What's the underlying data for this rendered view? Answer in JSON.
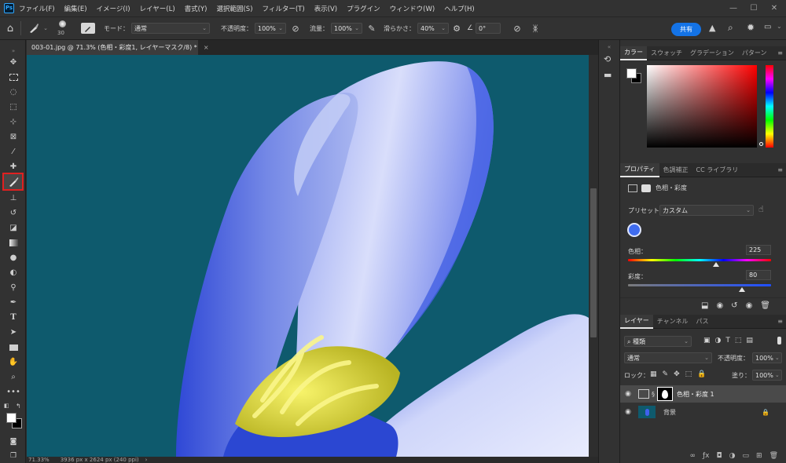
{
  "app": {
    "logo": "Ps"
  },
  "menu": [
    "ファイル(F)",
    "編集(E)",
    "イメージ(I)",
    "レイヤー(L)",
    "書式(Y)",
    "選択範囲(S)",
    "フィルター(T)",
    "表示(V)",
    "プラグイン",
    "ウィンドウ(W)",
    "ヘルプ(H)"
  ],
  "options": {
    "brush_size": "30",
    "mode_label": "モード：",
    "mode_value": "通常",
    "opacity_label": "不透明度：",
    "opacity_value": "100%",
    "flow_label": "流量：",
    "flow_value": "100%",
    "smoothing_label": "滑らかさ：",
    "smoothing_value": "40%",
    "angle_value": "0°",
    "share_label": "共有"
  },
  "document": {
    "tab_title": "003-01.jpg @ 71.3% (色相・彩度1, レイヤーマスク/8) *",
    "status_zoom": "71.33%",
    "status_info": "3936 px x 2624 px (240 ppi)"
  },
  "color_panel": {
    "tabs": [
      "カラー",
      "スウォッチ",
      "グラデーション",
      "パターン"
    ],
    "foreground": "#ffffff",
    "background": "#000000",
    "picker_hue": "#ff0000"
  },
  "properties_panel": {
    "tabs": [
      "プロパティ",
      "色調補正",
      "CC ライブラリ"
    ],
    "adjustment_name": "色相・彩度",
    "preset_label": "プリセット：",
    "preset_value": "カスタム",
    "hue_label": "色相：",
    "hue_value": "225",
    "saturation_label": "彩度：",
    "saturation_value": "80"
  },
  "layers_panel": {
    "tabs": [
      "レイヤー",
      "チャンネル",
      "パス"
    ],
    "filter_label": "種類",
    "blend_mode": "通常",
    "opacity_label": "不透明度：",
    "opacity_value": "100%",
    "lock_label": "ロック：",
    "fill_label": "塗り：",
    "fill_value": "100%",
    "layers": [
      {
        "name": "色相・彩度 1",
        "selected": true
      },
      {
        "name": "背景",
        "selected": false
      }
    ]
  }
}
